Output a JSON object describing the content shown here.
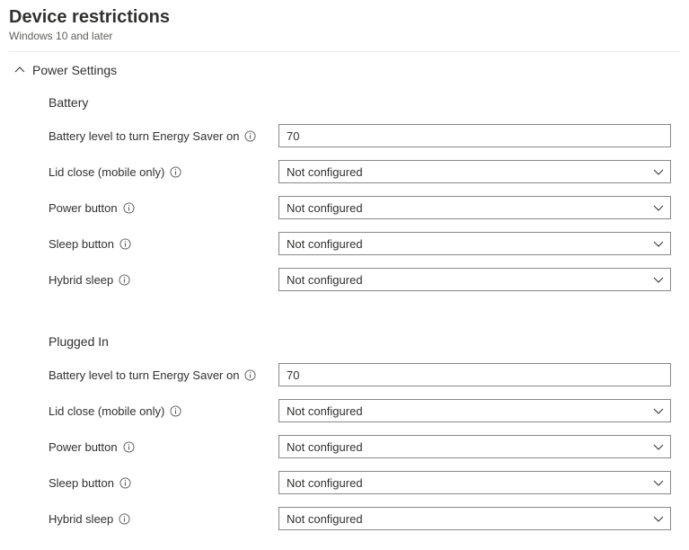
{
  "header": {
    "title": "Device restrictions",
    "subtitle": "Windows 10 and later"
  },
  "section": {
    "title": "Power Settings"
  },
  "battery": {
    "heading": "Battery",
    "energy_saver": {
      "label": "Battery level to turn Energy Saver on",
      "value": "70"
    },
    "lid_close": {
      "label": "Lid close (mobile only)",
      "value": "Not configured"
    },
    "power_button": {
      "label": "Power button",
      "value": "Not configured"
    },
    "sleep_button": {
      "label": "Sleep button",
      "value": "Not configured"
    },
    "hybrid_sleep": {
      "label": "Hybrid sleep",
      "value": "Not configured"
    }
  },
  "plugged": {
    "heading": "Plugged In",
    "energy_saver": {
      "label": "Battery level to turn Energy Saver on",
      "value": "70"
    },
    "lid_close": {
      "label": "Lid close (mobile only)",
      "value": "Not configured"
    },
    "power_button": {
      "label": "Power button",
      "value": "Not configured"
    },
    "sleep_button": {
      "label": "Sleep button",
      "value": "Not configured"
    },
    "hybrid_sleep": {
      "label": "Hybrid sleep",
      "value": "Not configured"
    }
  }
}
